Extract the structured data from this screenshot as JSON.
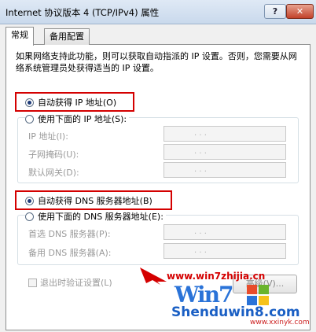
{
  "window": {
    "title": "Internet 协议版本 4 (TCP/IPv4) 属性",
    "help_glyph": "?",
    "close_glyph": "✕"
  },
  "tabs": [
    "常规",
    "备用配置"
  ],
  "description": "如果网络支持此功能，则可以获取自动指派的 IP 设置。否则，您需要从网络系统管理员处获得适当的 IP 设置。",
  "ip": {
    "auto_label": "自动获得 IP 地址(O)",
    "auto_selected": true,
    "manual_label": "使用下面的 IP 地址(S):",
    "fields": [
      {
        "label": "IP 地址(I):",
        "value": ". . ."
      },
      {
        "label": "子网掩码(U):",
        "value": ". . ."
      },
      {
        "label": "默认网关(D):",
        "value": ". . ."
      }
    ]
  },
  "dns": {
    "auto_label": "自动获得 DNS 服务器地址(B)",
    "auto_selected": true,
    "manual_label": "使用下面的 DNS 服务器地址(E):",
    "fields": [
      {
        "label": "首选 DNS 服务器(P):",
        "value": ". . ."
      },
      {
        "label": "备用 DNS 服务器(A):",
        "value": ". . ."
      }
    ]
  },
  "validate_label": "退出时验证设置(L)",
  "advanced_label": "高级(V)...",
  "watermark": {
    "url": "www.win7zhijia.cn",
    "logo_text": "Win7",
    "brand": "Shenduwin8.com",
    "sub": "www.xxinyk.com"
  },
  "colors": {
    "highlight_box": "#d40000",
    "title_gradient": "#c9d9ec",
    "close_button": "#c2422a"
  }
}
